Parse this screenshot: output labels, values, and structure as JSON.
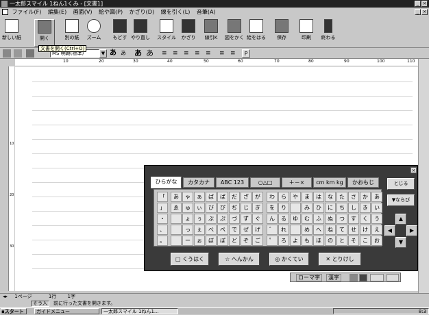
{
  "window": {
    "title": "一太郎スマイル 1ねん1くみ - [文書1]",
    "minimize": "_",
    "maximize": "▫",
    "close": "×",
    "doc_minimize": "_",
    "doc_close": "×"
  },
  "menu": [
    "ファイル(F)",
    "編集(E)",
    "画面(V)",
    "絵や図(P)",
    "かざり(D)",
    "線を引く(L)",
    "音筆(A)"
  ],
  "toolbar": [
    {
      "label": "新しい紙",
      "icon": "new-page-icon"
    },
    {
      "label": "開く",
      "icon": "open-folder-icon"
    },
    {
      "label": "別の紙",
      "icon": "another-paper-icon"
    },
    {
      "label": "ズーム",
      "icon": "zoom-icon"
    },
    {
      "label": "もどす",
      "icon": "undo-icon"
    },
    {
      "label": "やり直し",
      "icon": "redo-icon"
    },
    {
      "label": "スタイル",
      "icon": "style-icon"
    },
    {
      "label": "かざり",
      "icon": "decorate-icon"
    },
    {
      "label": "線引K",
      "icon": "draw-line-icon"
    },
    {
      "label": "図をかく",
      "icon": "draw-figure-icon"
    },
    {
      "label": "絵をはる",
      "icon": "paste-picture-icon"
    },
    {
      "label": "保存",
      "icon": "save-icon"
    },
    {
      "label": "印刷",
      "icon": "print-icon"
    },
    {
      "label": "終わる",
      "icon": "exit-icon"
    }
  ],
  "tooltip": "文書を開く(Ctrl+O)",
  "format": {
    "font_name": "MS 明朝(標準)",
    "dropdown": "▼",
    "size_a_small": "あ",
    "size_a_mixed": "あ",
    "bold_a": "あ",
    "outline_a": "あ",
    "align_symbols": [
      "≡",
      "≡",
      "≡",
      "≡",
      "≡",
      "≡",
      "≡"
    ],
    "para_symbol": "P"
  },
  "ruler": [
    "10",
    "20",
    "30",
    "40",
    "50",
    "60",
    "70",
    "80",
    "90",
    "100",
    "110"
  ],
  "vruler": [
    "10",
    "20",
    "30"
  ],
  "palette": {
    "close": "×",
    "tabs": [
      "ひらがな",
      "カタカナ",
      "ABC 123",
      "○△□",
      "＋－×",
      "cm km kg",
      "かおもじ"
    ],
    "rows": [
      [
        "「",
        "あ",
        "ゃ",
        "ぁ",
        "ば",
        "ぱ",
        "だ",
        "ざ",
        "が",
        "わ",
        "ら",
        "や",
        "ま",
        "は",
        "な",
        "た",
        "さ",
        "か",
        "あ"
      ],
      [
        "」",
        "ゑ",
        "ゅ",
        "ぃ",
        "び",
        "ぴ",
        "ぢ",
        "じ",
        "ぎ",
        "を",
        "り",
        "",
        "み",
        "ひ",
        "に",
        "ち",
        "し",
        "き",
        "い"
      ],
      [
        "・",
        "",
        "ょ",
        "ぅ",
        "ぶ",
        "ぷ",
        "づ",
        "ず",
        "ぐ",
        "ん",
        "る",
        "ゆ",
        "む",
        "ふ",
        "ぬ",
        "つ",
        "す",
        "く",
        "う"
      ],
      [
        "、",
        "",
        "っ",
        "ぇ",
        "べ",
        "ぺ",
        "で",
        "ぜ",
        "げ",
        "゛",
        "れ",
        "",
        "め",
        "へ",
        "ね",
        "て",
        "せ",
        "け",
        "え"
      ],
      [
        "。",
        "",
        "ー",
        "ぉ",
        "ぼ",
        "ぽ",
        "ど",
        "ぞ",
        "ご",
        "゜",
        "ろ",
        "よ",
        "も",
        "ほ",
        "の",
        "と",
        "そ",
        "こ",
        "お"
      ]
    ],
    "side": {
      "close_btn": "とじる",
      "sort_btn": "▼ならび"
    },
    "arrows": {
      "up": "▲",
      "down": "▼",
      "left": "◀",
      "right": "▶"
    },
    "actions": [
      "くうはく",
      "へんかん",
      "かくてい",
      "とりけし"
    ]
  },
  "ime": {
    "mode": "ローマ字",
    "kanji": "漢字"
  },
  "hscroll": {
    "page": "1ページ",
    "line": "1行",
    "char": "1字"
  },
  "status": {
    "insert": "そう入",
    "message": "前に行った文書を開きます。"
  },
  "taskbar": {
    "start": "スタート",
    "items": [
      "ガイドメニュー",
      "一太郎スマイル 1ねん1..."
    ],
    "clock": "8:3"
  }
}
